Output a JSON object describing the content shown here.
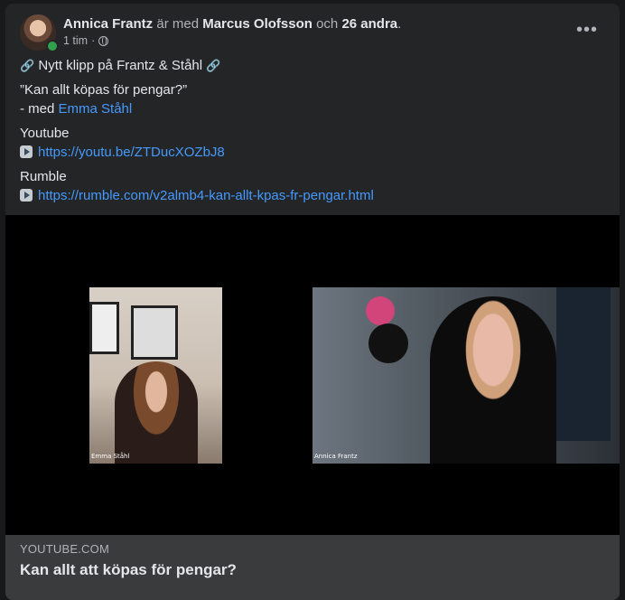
{
  "post": {
    "author": "Annica Frantz",
    "with_text": " är med ",
    "tagged_person": "Marcus Olofsson",
    "and_text": " och ",
    "others": "26 andra",
    "period": ".",
    "time": "1 tim",
    "dot": "·",
    "more": "•••"
  },
  "content": {
    "line1": "Nytt klipp på Frantz & Ståhl",
    "line2": "”Kan allt köpas för pengar?”",
    "line3_prefix": "- med ",
    "line3_link": "Emma Ståhl",
    "youtube_label": "Youtube",
    "youtube_url": "https://youtu.be/ZTDucXOZbJ8",
    "rumble_label": "Rumble",
    "rumble_url": "https://rumble.com/v2almb4-kan-allt-kpas-fr-pengar.html"
  },
  "video": {
    "left_name": "Emma Ståhl",
    "right_name": "Annica Frantz"
  },
  "link_preview": {
    "domain": "YOUTUBE.COM",
    "title": "Kan allt att köpas för pengar?"
  },
  "icons": {
    "chain": "chain-link-icon",
    "play": "play-icon",
    "globe": "globe-icon",
    "more": "more-options-icon"
  },
  "colors": {
    "background": "#18191a",
    "card": "#242526",
    "link": "#4599ff",
    "online": "#31a24c",
    "preview": "#3a3b3c"
  }
}
